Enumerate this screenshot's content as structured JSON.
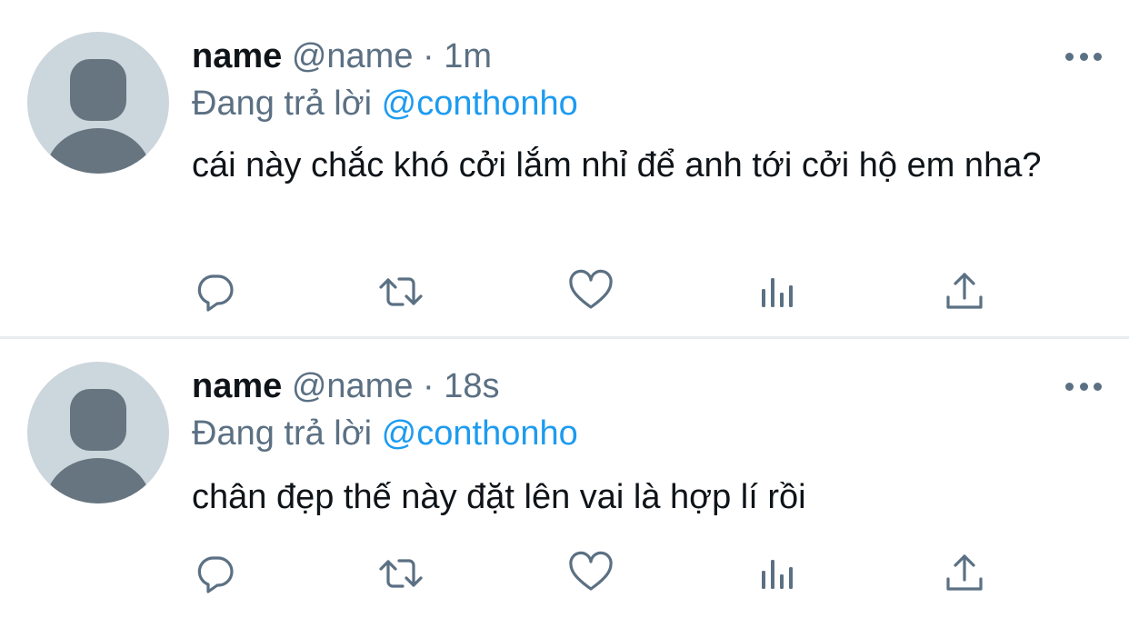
{
  "colors": {
    "text_primary": "#0f1419",
    "text_secondary": "#5b7083",
    "accent": "#1d9bf0",
    "divider": "#e8ecef",
    "avatar_bg": "#ccd6dd",
    "avatar_fg": "#66757f"
  },
  "tweets": [
    {
      "display_name": "name",
      "handle": "@name",
      "separator": "·",
      "time": "1m",
      "reply_prefix": "Đang trả lời",
      "reply_to": "@conthonho",
      "text": "cái này chắc khó cởi lắm nhỉ để anh tới cởi hộ em nha?",
      "icons": {
        "more": "more-horizontal-icon",
        "reply": "reply-icon",
        "retweet": "retweet-icon",
        "like": "heart-icon",
        "stats": "analytics-icon",
        "share": "share-icon"
      }
    },
    {
      "display_name": "name",
      "handle": "@name",
      "separator": "·",
      "time": "18s",
      "reply_prefix": "Đang trả lời",
      "reply_to": "@conthonho",
      "text": "chân đẹp thế này đặt lên vai là hợp lí rồi",
      "icons": {
        "more": "more-horizontal-icon",
        "reply": "reply-icon",
        "retweet": "retweet-icon",
        "like": "heart-icon",
        "stats": "analytics-icon",
        "share": "share-icon"
      }
    }
  ]
}
